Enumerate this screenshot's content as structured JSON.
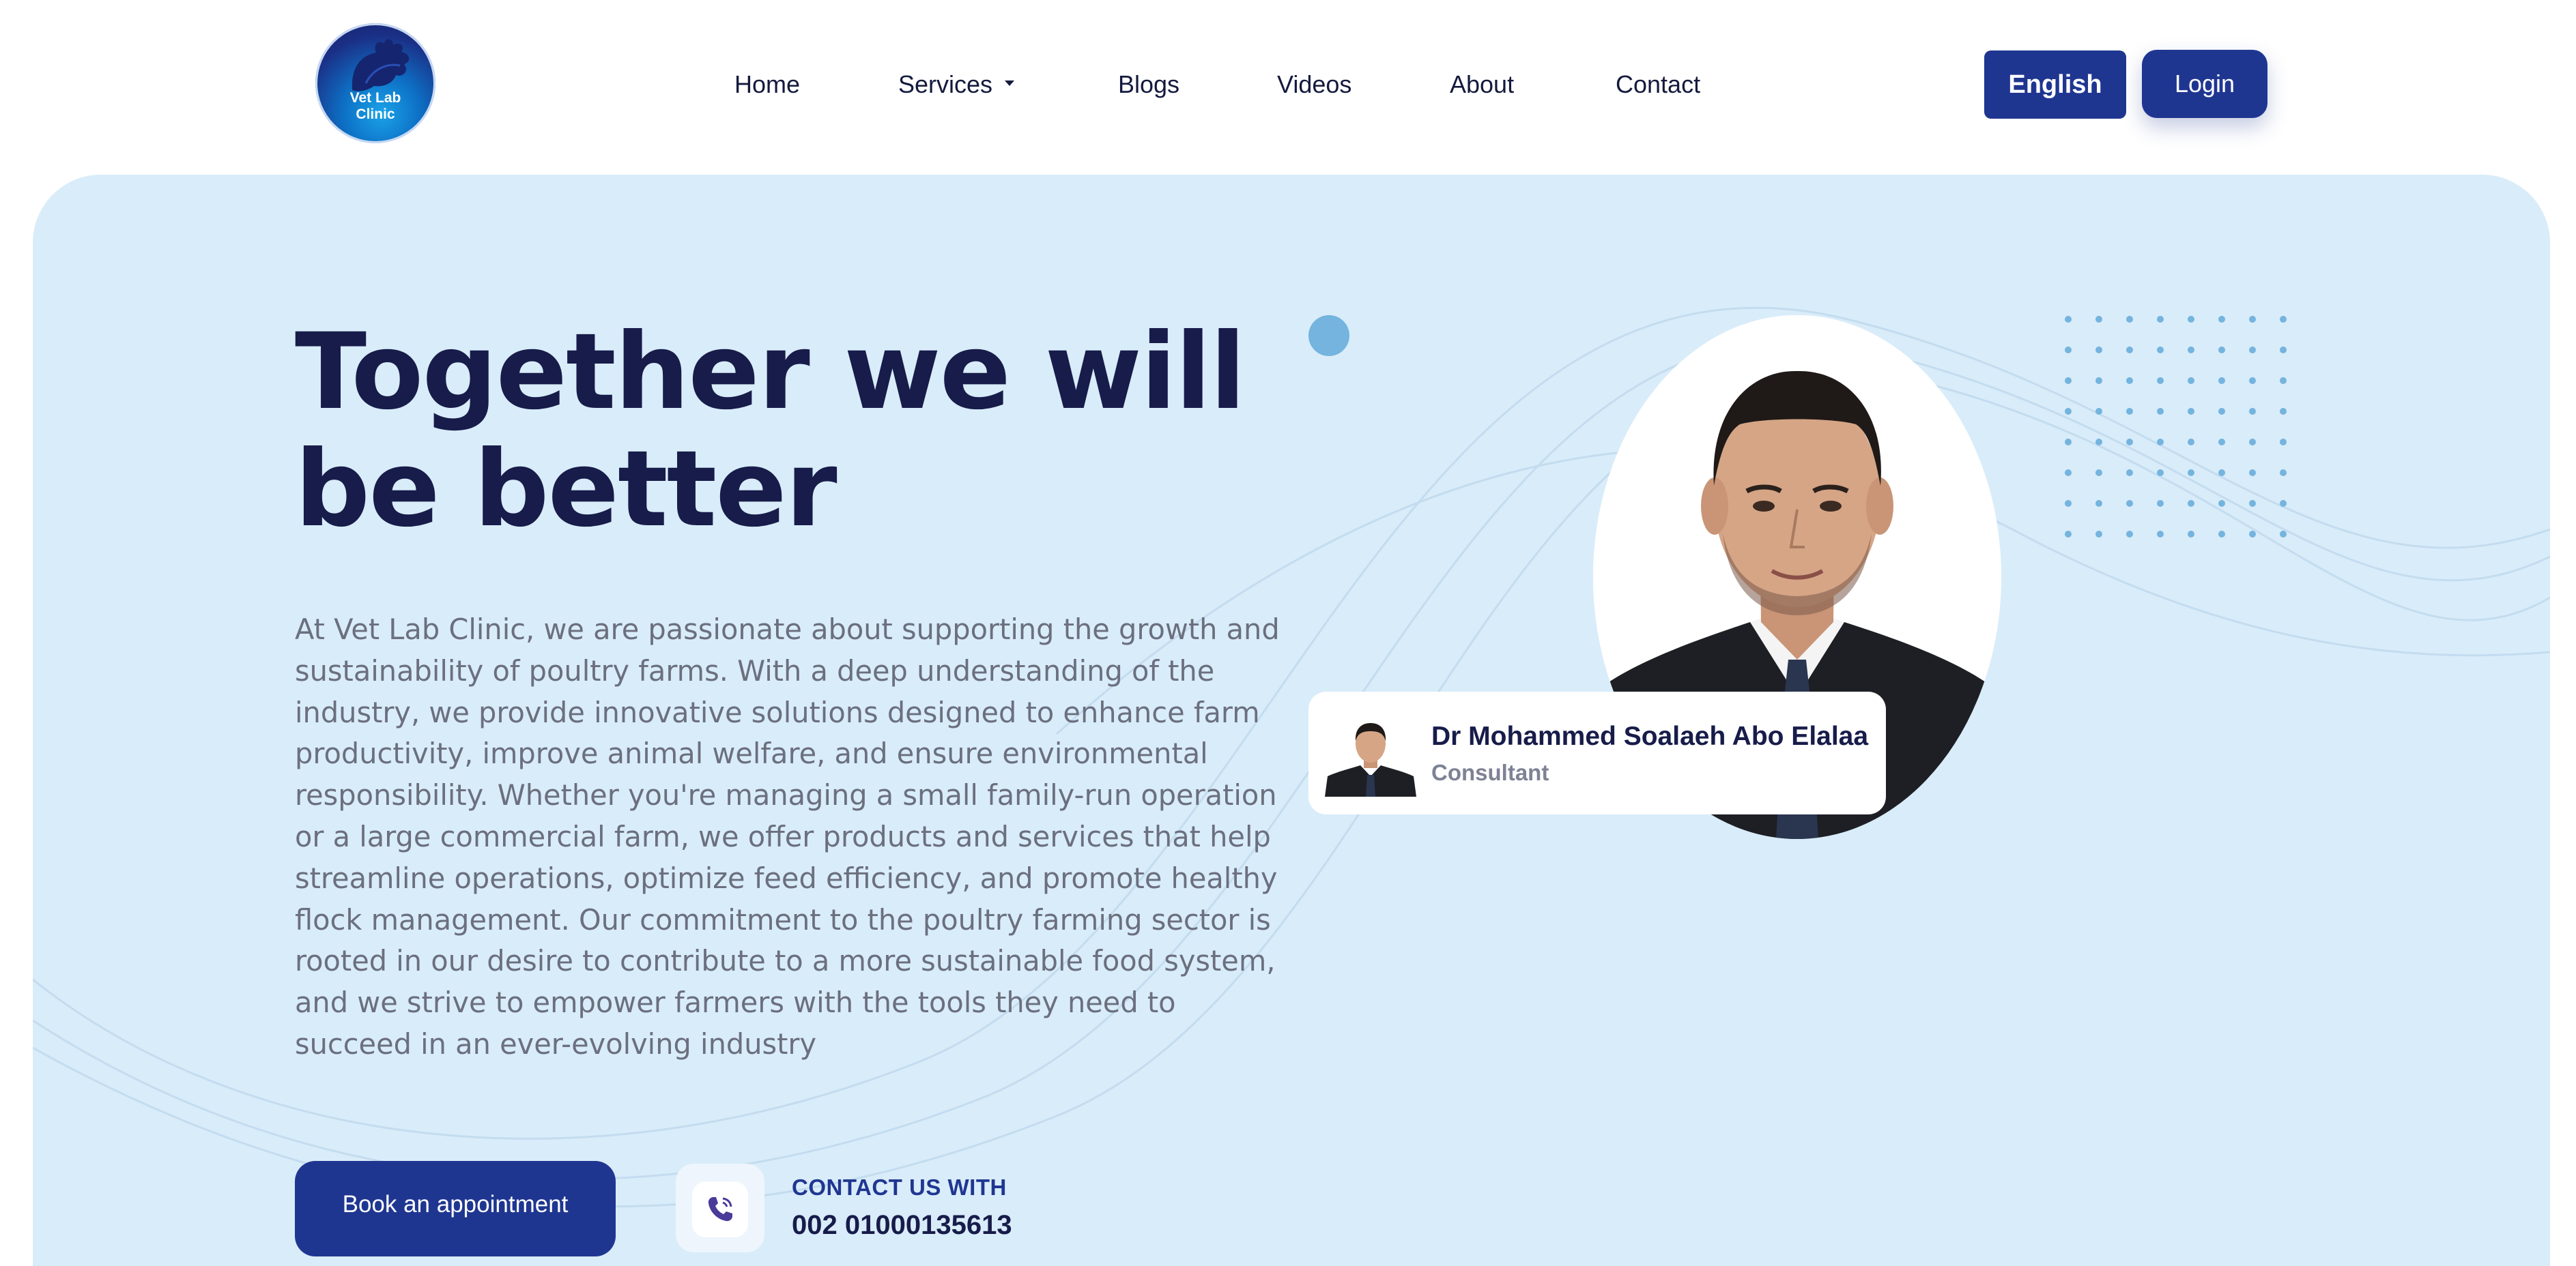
{
  "header": {
    "logo_text": "Vet Lab\nClinic",
    "nav": [
      {
        "label": "Home"
      },
      {
        "label": "Services",
        "has_dropdown": true
      },
      {
        "label": "Blogs"
      },
      {
        "label": "Videos"
      },
      {
        "label": "About"
      },
      {
        "label": "Contact"
      }
    ],
    "language_label": "English",
    "login_label": "Login"
  },
  "hero": {
    "headline": "Together we will be better",
    "paragraph": "At Vet Lab Clinic, we are passionate about supporting the growth and sustainability of poultry farms. With a deep understanding of the industry, we provide innovative solutions designed to enhance farm productivity, improve animal welfare, and ensure environmental responsibility. Whether you're managing a small family-run operation or a large commercial farm, we offer products and services that help streamline operations, optimize feed efficiency, and promote healthy flock management. Our commitment to the poultry farming sector is rooted in our desire to contribute to a more sustainable food system, and we strive to empower farmers with the tools they need to succeed in an ever-evolving industry",
    "book_button": "Book an appointment",
    "contact_label": "CONTACT US WITH",
    "contact_phone": "002 01000135613"
  },
  "doctor": {
    "name": "Dr Mohammed Soalaeh Abo Elalaa",
    "role": "Consultant"
  },
  "colors": {
    "primary": "#1f3691",
    "hero_bg": "#d9ecf9",
    "headline": "#171c4a",
    "body_text": "#6b6f7e",
    "accent_dot": "#74b4df"
  }
}
